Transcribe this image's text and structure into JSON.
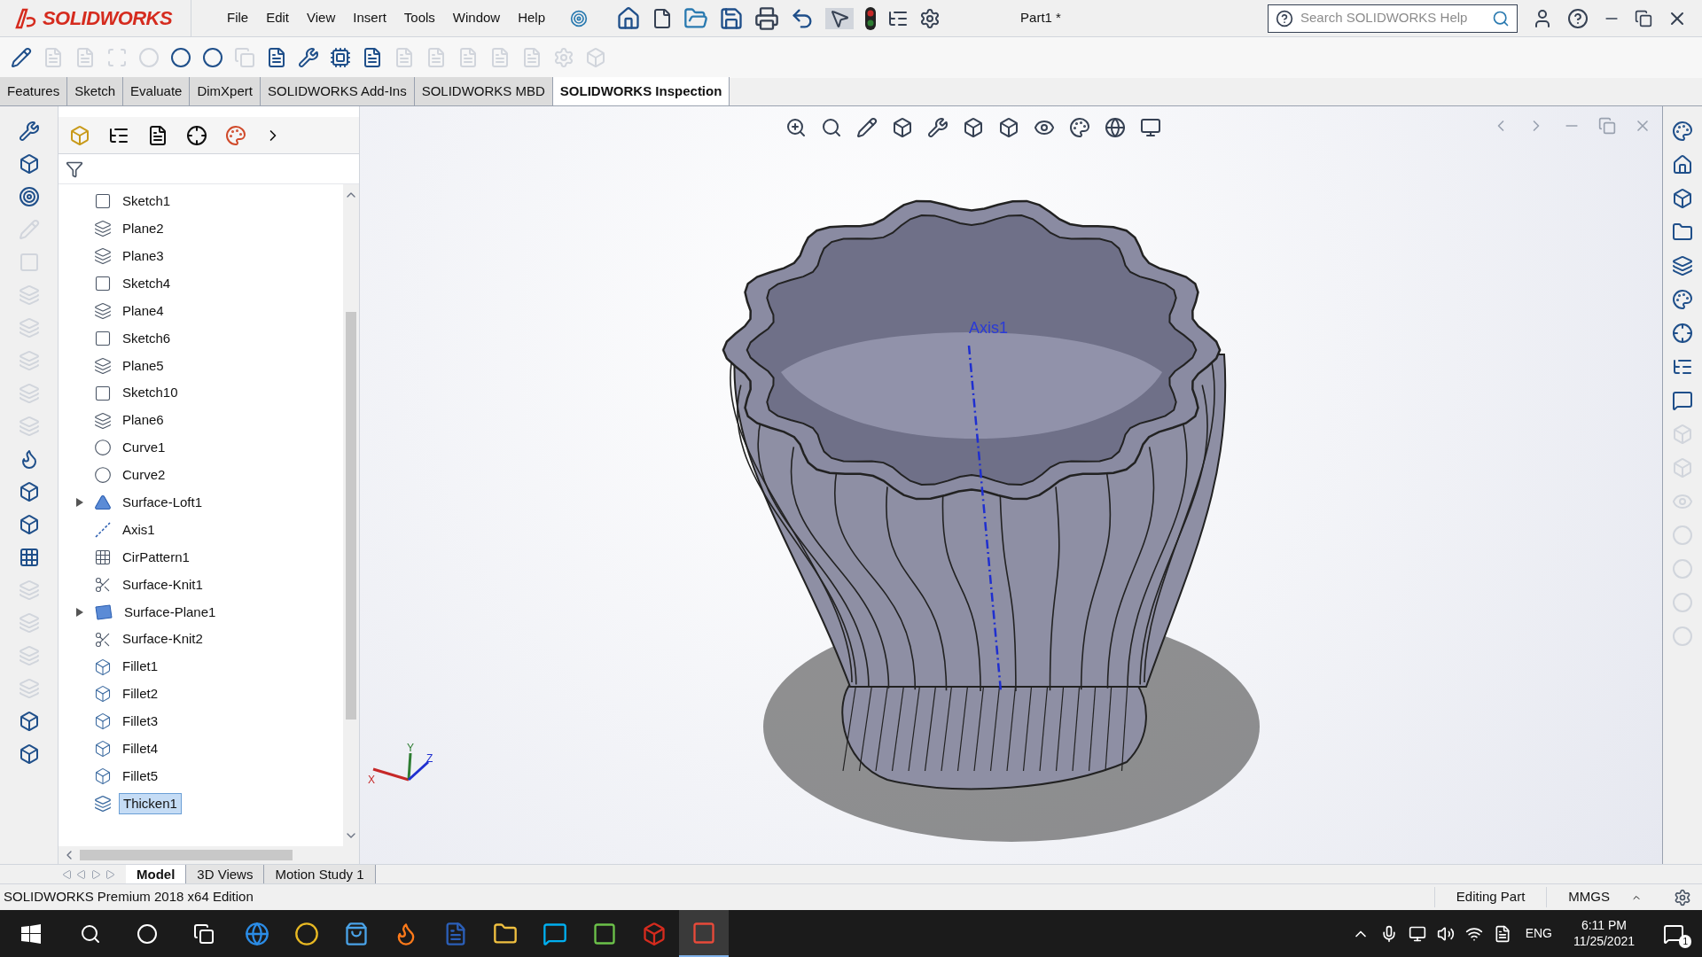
{
  "app": {
    "logo": "SOLIDWORKS",
    "menu": [
      "File",
      "Edit",
      "View",
      "Insert",
      "Tools",
      "Window",
      "Help"
    ],
    "document_title": "Part1 *",
    "search": {
      "placeholder": "Search SOLIDWORKS Help"
    }
  },
  "command_tabs": [
    {
      "label": "Features",
      "selected": false
    },
    {
      "label": "Sketch",
      "selected": false
    },
    {
      "label": "Evaluate",
      "selected": false
    },
    {
      "label": "DimXpert",
      "selected": false
    },
    {
      "label": "SOLIDWORKS Add-Ins",
      "selected": false
    },
    {
      "label": "SOLIDWORKS MBD",
      "selected": false
    },
    {
      "label": "SOLIDWORKS Inspection",
      "selected": true
    }
  ],
  "feature_tree": [
    {
      "name": "Sketch1",
      "kind": "sketch",
      "expandable": false,
      "selected": false
    },
    {
      "name": "Plane2",
      "kind": "plane",
      "expandable": false,
      "selected": false
    },
    {
      "name": "Plane3",
      "kind": "plane",
      "expandable": false,
      "selected": false
    },
    {
      "name": "Sketch4",
      "kind": "sketch",
      "expandable": false,
      "selected": false
    },
    {
      "name": "Plane4",
      "kind": "plane",
      "expandable": false,
      "selected": false
    },
    {
      "name": "Sketch6",
      "kind": "sketch",
      "expandable": false,
      "selected": false
    },
    {
      "name": "Plane5",
      "kind": "plane",
      "expandable": false,
      "selected": false
    },
    {
      "name": "Sketch10",
      "kind": "sketch",
      "expandable": false,
      "selected": false
    },
    {
      "name": "Plane6",
      "kind": "plane",
      "expandable": false,
      "selected": false
    },
    {
      "name": "Curve1",
      "kind": "curve",
      "expandable": false,
      "selected": false
    },
    {
      "name": "Curve2",
      "kind": "curve",
      "expandable": false,
      "selected": false
    },
    {
      "name": "Surface-Loft1",
      "kind": "loft",
      "expandable": true,
      "selected": false
    },
    {
      "name": "Axis1",
      "kind": "axis",
      "expandable": false,
      "selected": false
    },
    {
      "name": "CirPattern1",
      "kind": "pattern",
      "expandable": false,
      "selected": false
    },
    {
      "name": "Surface-Knit1",
      "kind": "knit",
      "expandable": false,
      "selected": false
    },
    {
      "name": "Surface-Plane1",
      "kind": "surface",
      "expandable": true,
      "selected": false
    },
    {
      "name": "Surface-Knit2",
      "kind": "knit",
      "expandable": false,
      "selected": false
    },
    {
      "name": "Fillet1",
      "kind": "fillet",
      "expandable": false,
      "selected": false
    },
    {
      "name": "Fillet2",
      "kind": "fillet",
      "expandable": false,
      "selected": false
    },
    {
      "name": "Fillet3",
      "kind": "fillet",
      "expandable": false,
      "selected": false
    },
    {
      "name": "Fillet4",
      "kind": "fillet",
      "expandable": false,
      "selected": false
    },
    {
      "name": "Fillet5",
      "kind": "fillet",
      "expandable": false,
      "selected": false
    },
    {
      "name": "Thicken1",
      "kind": "thicken",
      "expandable": false,
      "selected": true
    }
  ],
  "viewport": {
    "axis_label": "Axis1",
    "triad": [
      "X",
      "Y",
      "Z"
    ]
  },
  "bottom_tabs": [
    {
      "label": "Model",
      "selected": true
    },
    {
      "label": "3D Views",
      "selected": false
    },
    {
      "label": "Motion Study 1",
      "selected": false
    }
  ],
  "status_bar": {
    "edition": "SOLIDWORKS Premium 2018 x64 Edition",
    "mode": "Editing Part",
    "units": "MMGS"
  },
  "taskbar": {
    "language": "ENG",
    "time": "6:11 PM",
    "date": "11/25/2021",
    "notifications": "1"
  }
}
